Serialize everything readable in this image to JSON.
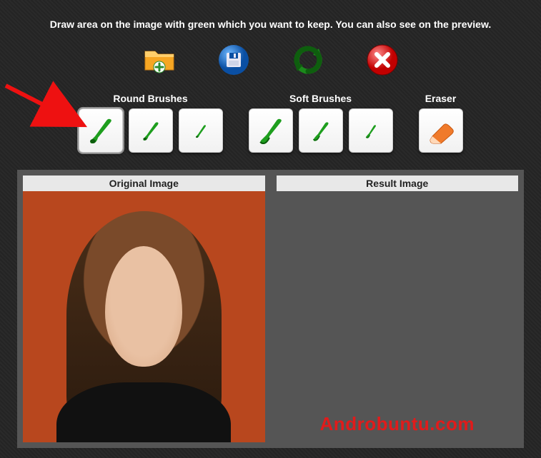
{
  "instruction": "Draw area on the image with green which you want to keep. You can also see on the preview.",
  "toolbar": {
    "open": "open-folder",
    "save": "save-disk",
    "refresh": "refresh",
    "close": "close"
  },
  "groups": {
    "round": {
      "label": "Round Brushes"
    },
    "soft": {
      "label": "Soft Brushes"
    },
    "eraser": {
      "label": "Eraser"
    }
  },
  "panels": {
    "original": {
      "label": "Original Image"
    },
    "result": {
      "label": "Result Image"
    }
  },
  "watermark": "Androbuntu.com"
}
